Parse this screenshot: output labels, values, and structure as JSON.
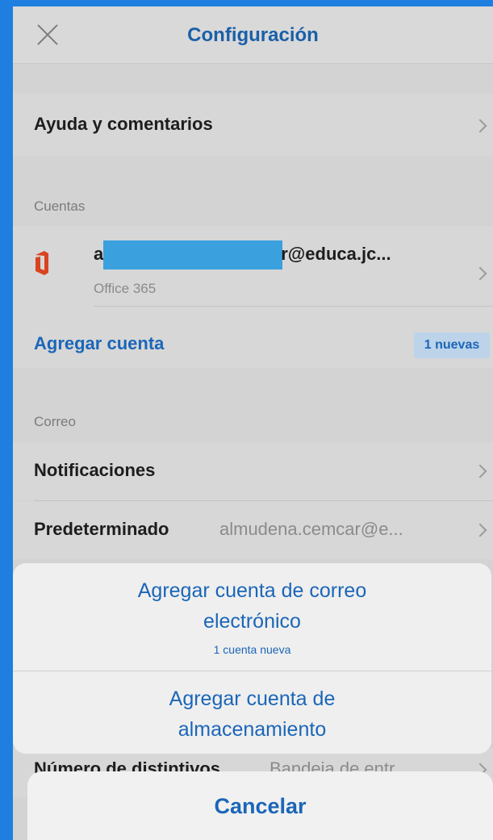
{
  "header": {
    "title": "Configuración"
  },
  "rows": {
    "help": "Ayuda y comentarios",
    "accounts_header": "Cuentas",
    "account": {
      "email_suffix": "r@educa.jc...",
      "email_prefix": "a",
      "provider": "Office 365"
    },
    "add_account": "Agregar cuenta",
    "new_badge": "1 nuevas",
    "mail_header": "Correo",
    "notifications": "Notificaciones",
    "default_label": "Predeterminado",
    "default_value": "almudena.cemcar@e...",
    "badges_label": "Número de distintivos",
    "badges_value": "Bandeja de entr..."
  },
  "sheet": {
    "add_email_line1": "Agregar cuenta de correo",
    "add_email_line2": "electrónico",
    "add_email_sub": "1 cuenta nueva",
    "add_storage_line1": "Agregar cuenta de",
    "add_storage_line2": "almacenamiento"
  },
  "cancel": {
    "label": "Cancelar"
  }
}
